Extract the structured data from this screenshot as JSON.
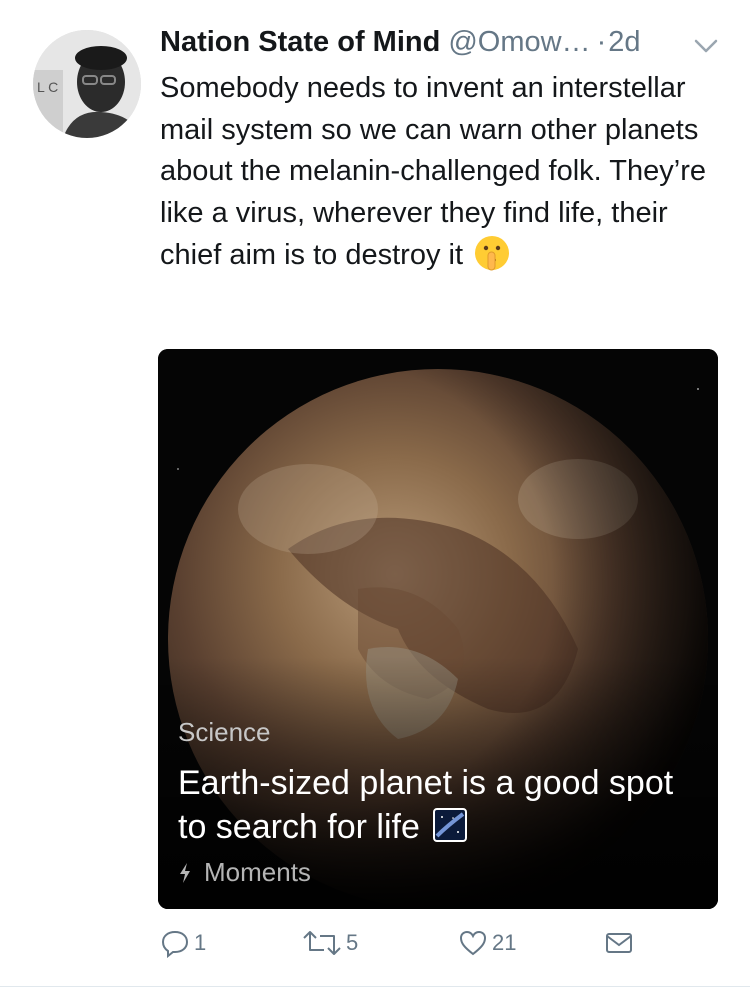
{
  "tweet": {
    "display_name": "Nation State of Mind",
    "handle": "@Omow…",
    "separator": "·",
    "timestamp": "2d",
    "text_main": "Somebody needs to invent an interstellar mail system so we can warn other planets about the melanin-challenged folk. They’re like a virus, wherever they find life, their chief aim is to destroy it",
    "emoji_icon": "shushing-face-icon"
  },
  "card": {
    "category": "Science",
    "title": "Earth-sized planet is a good spot to search for life",
    "title_icon": "milky-way-icon",
    "source": "Moments",
    "source_icon": "lightning-bolt-icon"
  },
  "actions": {
    "replies": "1",
    "retweets": "5",
    "likes": "21"
  },
  "colors": {
    "text": "#14171a",
    "secondary": "#657786",
    "card_bg": "#000000"
  }
}
